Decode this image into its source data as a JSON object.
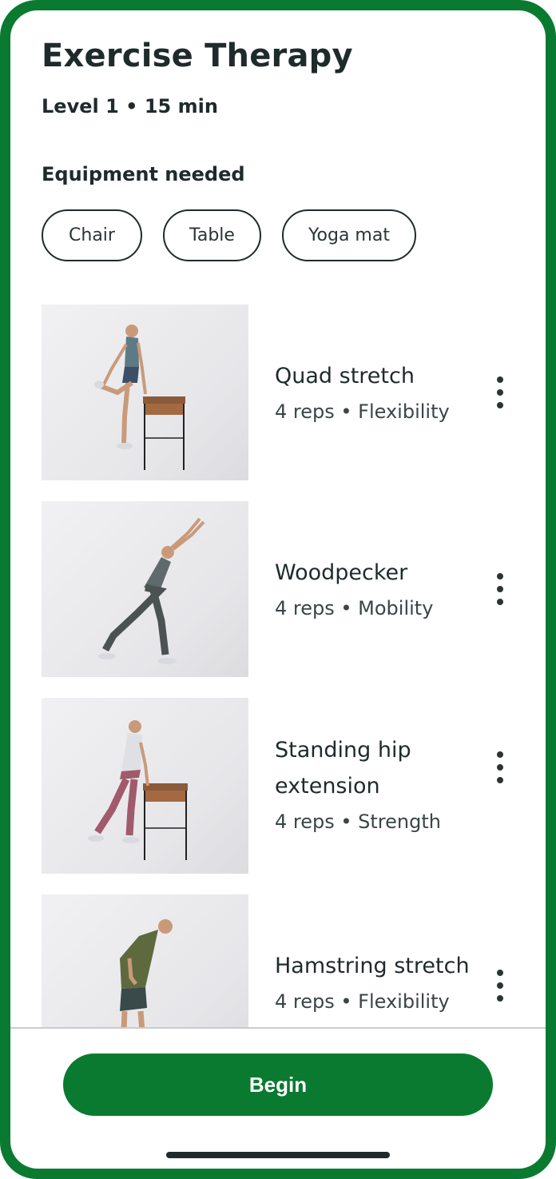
{
  "header": {
    "title": "Exercise Therapy",
    "subtitle": "Level 1 • 15 min"
  },
  "equipment": {
    "heading": "Equipment needed",
    "items": [
      "Chair",
      "Table",
      "Yoga mat"
    ]
  },
  "exercises": [
    {
      "name": "Quad stretch",
      "meta": "4 reps • Flexibility",
      "image": "quad-stretch-photo"
    },
    {
      "name": "Woodpecker",
      "meta": "4 reps • Mobility",
      "image": "woodpecker-photo"
    },
    {
      "name": "Standing hip extension",
      "meta": "4 reps • Strength",
      "image": "standing-hip-extension-photo"
    },
    {
      "name": "Hamstring stretch",
      "meta": "4 reps • Flexibility",
      "image": "hamstring-stretch-photo"
    }
  ],
  "footer": {
    "begin_label": "Begin"
  },
  "colors": {
    "brand_green": "#0a7a30",
    "text_dark": "#1f2a2b"
  },
  "icons": {
    "more": "more-vertical-icon"
  }
}
